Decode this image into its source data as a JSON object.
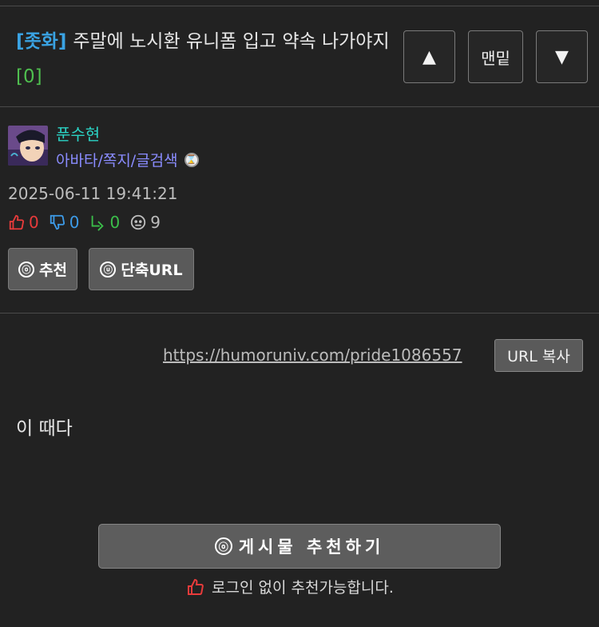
{
  "post": {
    "tag": "[좃화]",
    "title": "주말에 노시환 유니폼 입고 약속 나가야지",
    "comment_count": "[0]",
    "body": "이 때다"
  },
  "nav": {
    "up_label": "▲",
    "bottom_label": "맨밑",
    "down_label": "▼"
  },
  "author": {
    "name": "푼수현",
    "links": "아바타/쪽지/글검색",
    "badge_icon": "hourglass-icon"
  },
  "meta": {
    "datetime": "2025-06-11 19:41:21",
    "likes": "0",
    "dislikes": "0",
    "replies": "0",
    "views": "9"
  },
  "actions": {
    "recommend_label": "추천",
    "recommend_icon_glyph": "ⓞ",
    "short_url_label": "단축URL",
    "short_url_icon_glyph": "ⓤ"
  },
  "url": {
    "link": "https://humoruniv.com/pride1086557",
    "copy_label": "URL 복사"
  },
  "footer": {
    "recommend_post_label": "게시물  추천하기",
    "login_note": "로그인 없이 추천가능합니다."
  },
  "colors": {
    "tag": "#3aa3e3",
    "comment_count": "#4fbf4f",
    "author_name": "#2bd2c4",
    "author_links": "#8a8cff",
    "like": "#e83b3b",
    "dislike": "#3d9be8",
    "reply": "#3bbf4a"
  }
}
